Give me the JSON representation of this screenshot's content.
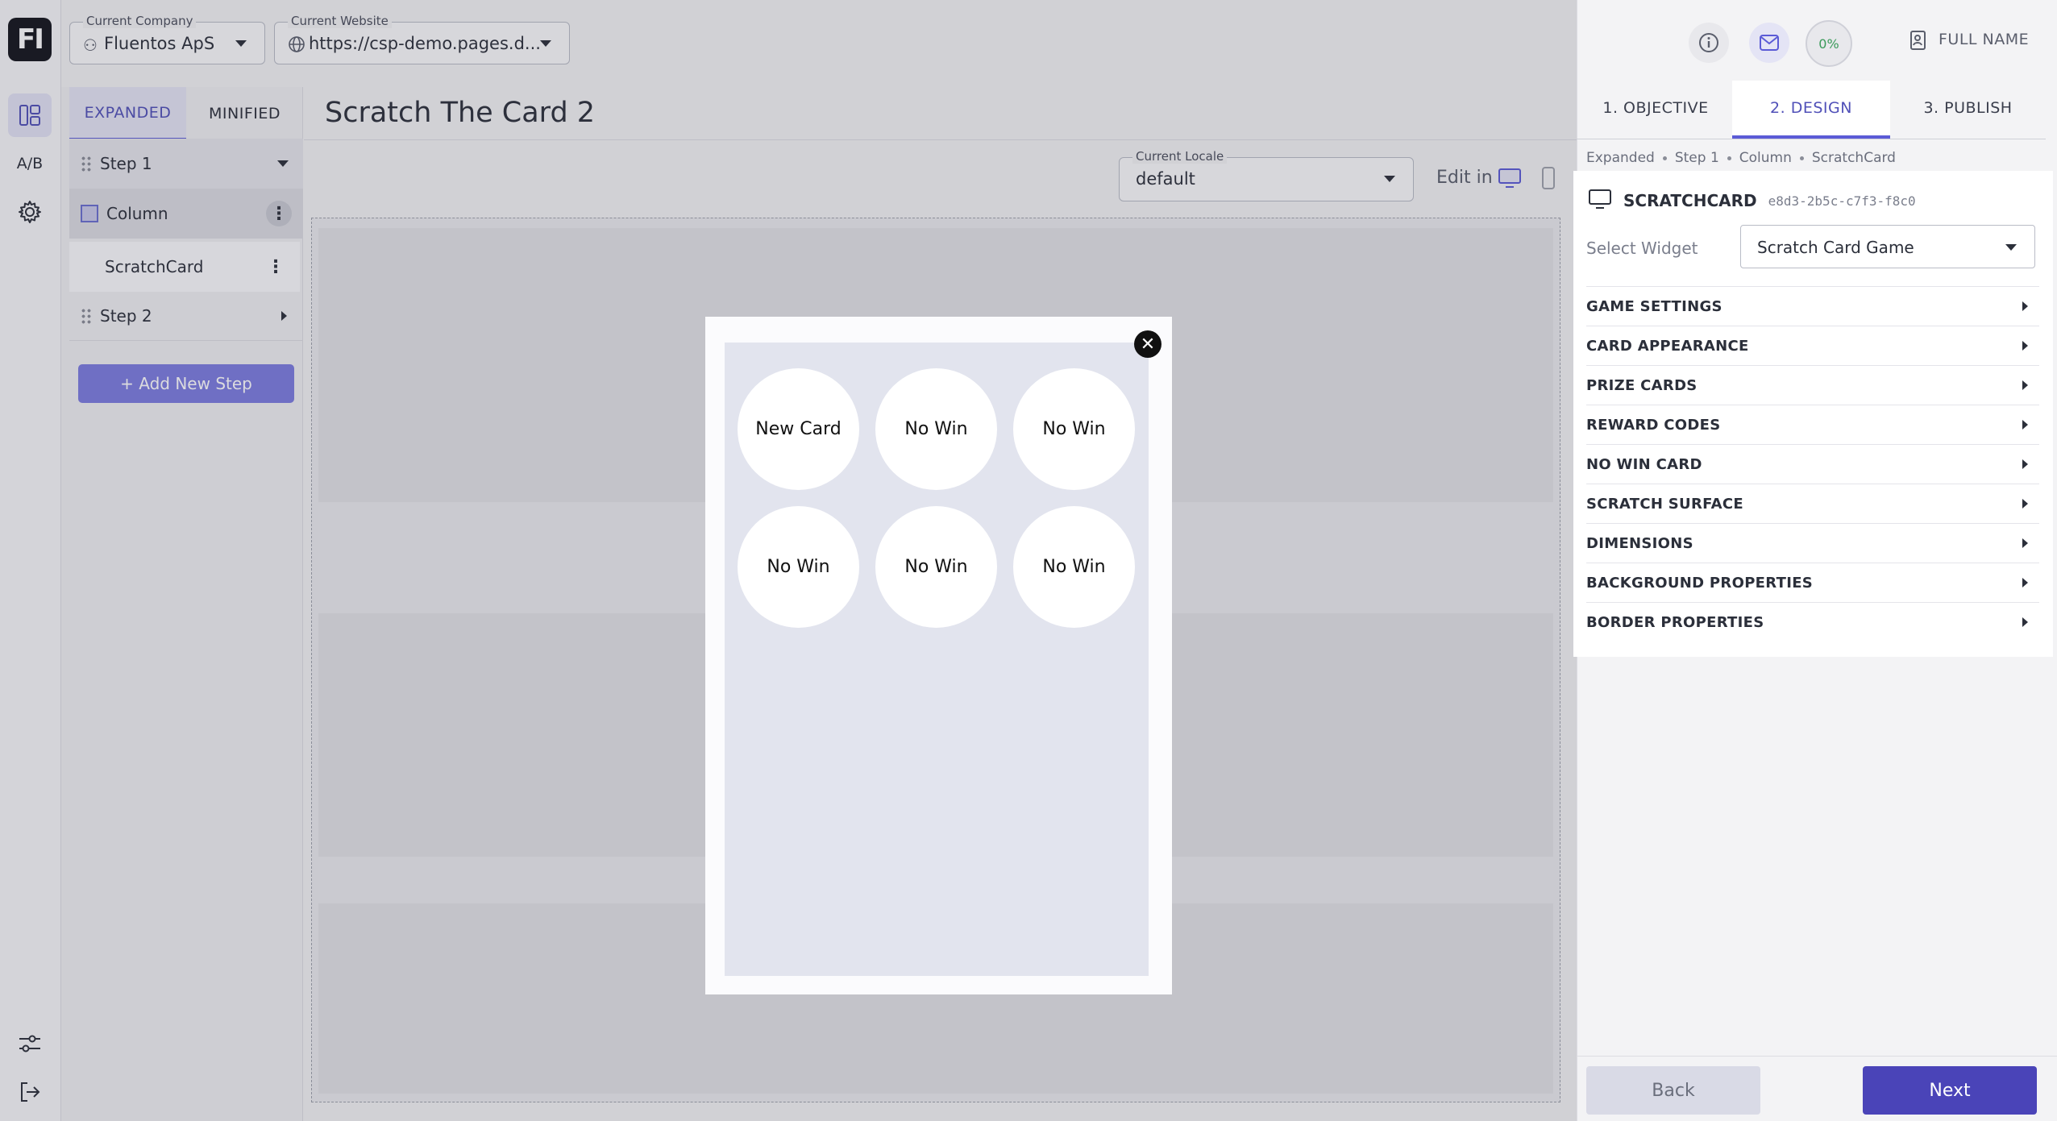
{
  "app": {
    "logo_text": "FI"
  },
  "rail": {
    "ab_label": "A/B"
  },
  "topbar": {
    "company_legend": "Current Company",
    "company_value": "Fluentos ApS",
    "website_legend": "Current Website",
    "website_value": "https://csp-demo.pages.d..."
  },
  "steps_panel": {
    "tabs": [
      "EXPANDED",
      "MINIFIED"
    ],
    "step1_label": "Step 1",
    "column_label": "Column",
    "widget_label": "ScratchCard",
    "step2_label": "Step 2",
    "add_step_label": "+ Add New Step"
  },
  "editor": {
    "page_title": "Scratch The Card 2",
    "locale_legend": "Current Locale",
    "locale_value": "default",
    "edit_in_label": "Edit in"
  },
  "modal": {
    "close_glyph": "✕",
    "cards": [
      "New Card",
      "No Win",
      "No Win",
      "No Win",
      "No Win",
      "No Win"
    ]
  },
  "right_panel": {
    "progress": "0%",
    "user_name": "FULL NAME",
    "tabs": [
      "1. OBJECTIVE",
      "2. DESIGN",
      "3. PUBLISH"
    ],
    "breadcrumbs": [
      "Expanded",
      "Step 1",
      "Column",
      "ScratchCard"
    ],
    "widget_title": "SCRATCHCARD",
    "widget_id": "e8d3-2b5c-c7f3-f8c0",
    "select_widget_label": "Select Widget",
    "select_widget_value": "Scratch Card Game",
    "sections": [
      "GAME SETTINGS",
      "CARD APPEARANCE",
      "PRIZE CARDS",
      "REWARD CODES",
      "NO WIN CARD",
      "SCRATCH SURFACE",
      "DIMENSIONS",
      "BACKGROUND PROPERTIES",
      "BORDER PROPERTIES"
    ],
    "back_label": "Back",
    "next_label": "Next"
  },
  "colors": {
    "accent": "#5b5bd6",
    "primary_button": "#4a44b8",
    "success": "#3a9a5a"
  }
}
